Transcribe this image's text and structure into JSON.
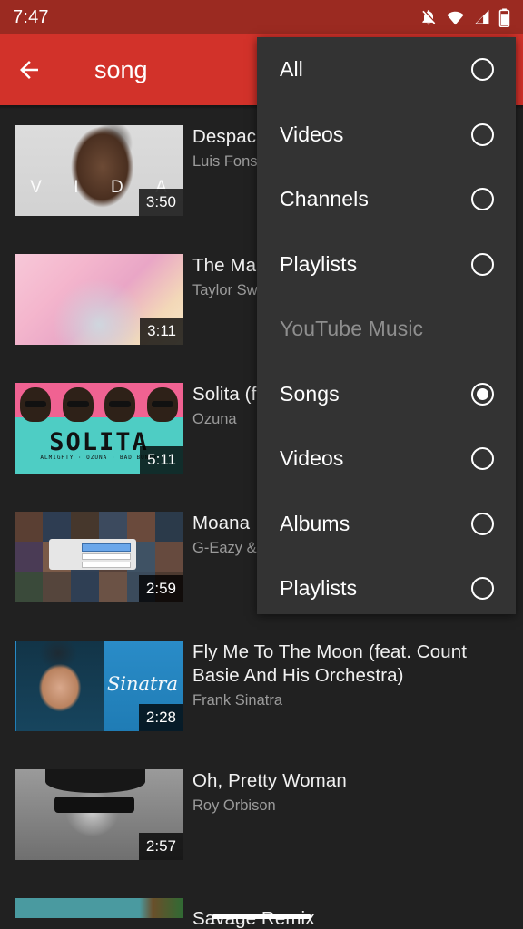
{
  "status_bar": {
    "time": "7:47",
    "icons": [
      "notifications-off-icon",
      "wifi-icon",
      "cellular-signal-icon",
      "battery-icon"
    ],
    "background": "#9B2A21"
  },
  "app_bar": {
    "back_label": "back-arrow",
    "query": "song",
    "background": "#D2322A"
  },
  "filter_menu": {
    "background": "#333333",
    "items": [
      {
        "label": "All",
        "type": "option",
        "selected": false
      },
      {
        "label": "Videos",
        "type": "option",
        "selected": false
      },
      {
        "label": "Channels",
        "type": "option",
        "selected": false
      },
      {
        "label": "Playlists",
        "type": "option",
        "selected": false
      },
      {
        "label": "YouTube Music",
        "type": "section",
        "selected": false
      },
      {
        "label": "Songs",
        "type": "option",
        "selected": true
      },
      {
        "label": "Videos",
        "type": "option",
        "selected": false
      },
      {
        "label": "Albums",
        "type": "option",
        "selected": false
      },
      {
        "label": "Playlists",
        "type": "option",
        "selected": false
      }
    ]
  },
  "results": [
    {
      "title": "Despacito",
      "artist": "Luis Fonsi",
      "duration": "3:50",
      "art": "art-vida",
      "art_text": [
        "V",
        "I",
        "D",
        "A"
      ]
    },
    {
      "title": "The Man",
      "artist": "Taylor Swift",
      "duration": "3:11",
      "art": "art-taylor",
      "art_text": []
    },
    {
      "title": "Solita (feat. Bad Bunny, Almighty)",
      "artist": "Ozuna",
      "duration": "5:11",
      "art": "art-solita",
      "art_text": [
        "SOLITA",
        "ALMIGHTY · OZUNA · BAD BUNNY"
      ]
    },
    {
      "title": "Moana",
      "artist": "G-Eazy & Jack Harlow",
      "duration": "2:59",
      "art": "art-moana",
      "art_text": []
    },
    {
      "title": "Fly Me To The Moon (feat. Count Basie And His Orchestra)",
      "artist": "Frank Sinatra",
      "duration": "2:28",
      "art": "art-sinatra",
      "art_text": [
        "Sinatra"
      ]
    },
    {
      "title": "Oh, Pretty Woman",
      "artist": "Roy Orbison",
      "duration": "2:57",
      "art": "art-orbison",
      "art_text": []
    },
    {
      "title": "Savage Remix",
      "artist": "",
      "duration": "",
      "art": "art-savage",
      "art_text": []
    }
  ],
  "nav_bar": {
    "gesture_pill": "home-gesture-pill"
  },
  "theme": {
    "page_background": "#212121",
    "accent_red": "#D2322A",
    "status_red": "#9B2A21",
    "menu_background": "#333333",
    "primary_text": "#F1F1F1",
    "secondary_text": "#9B9B9B",
    "section_text": "#8E8E8E"
  }
}
